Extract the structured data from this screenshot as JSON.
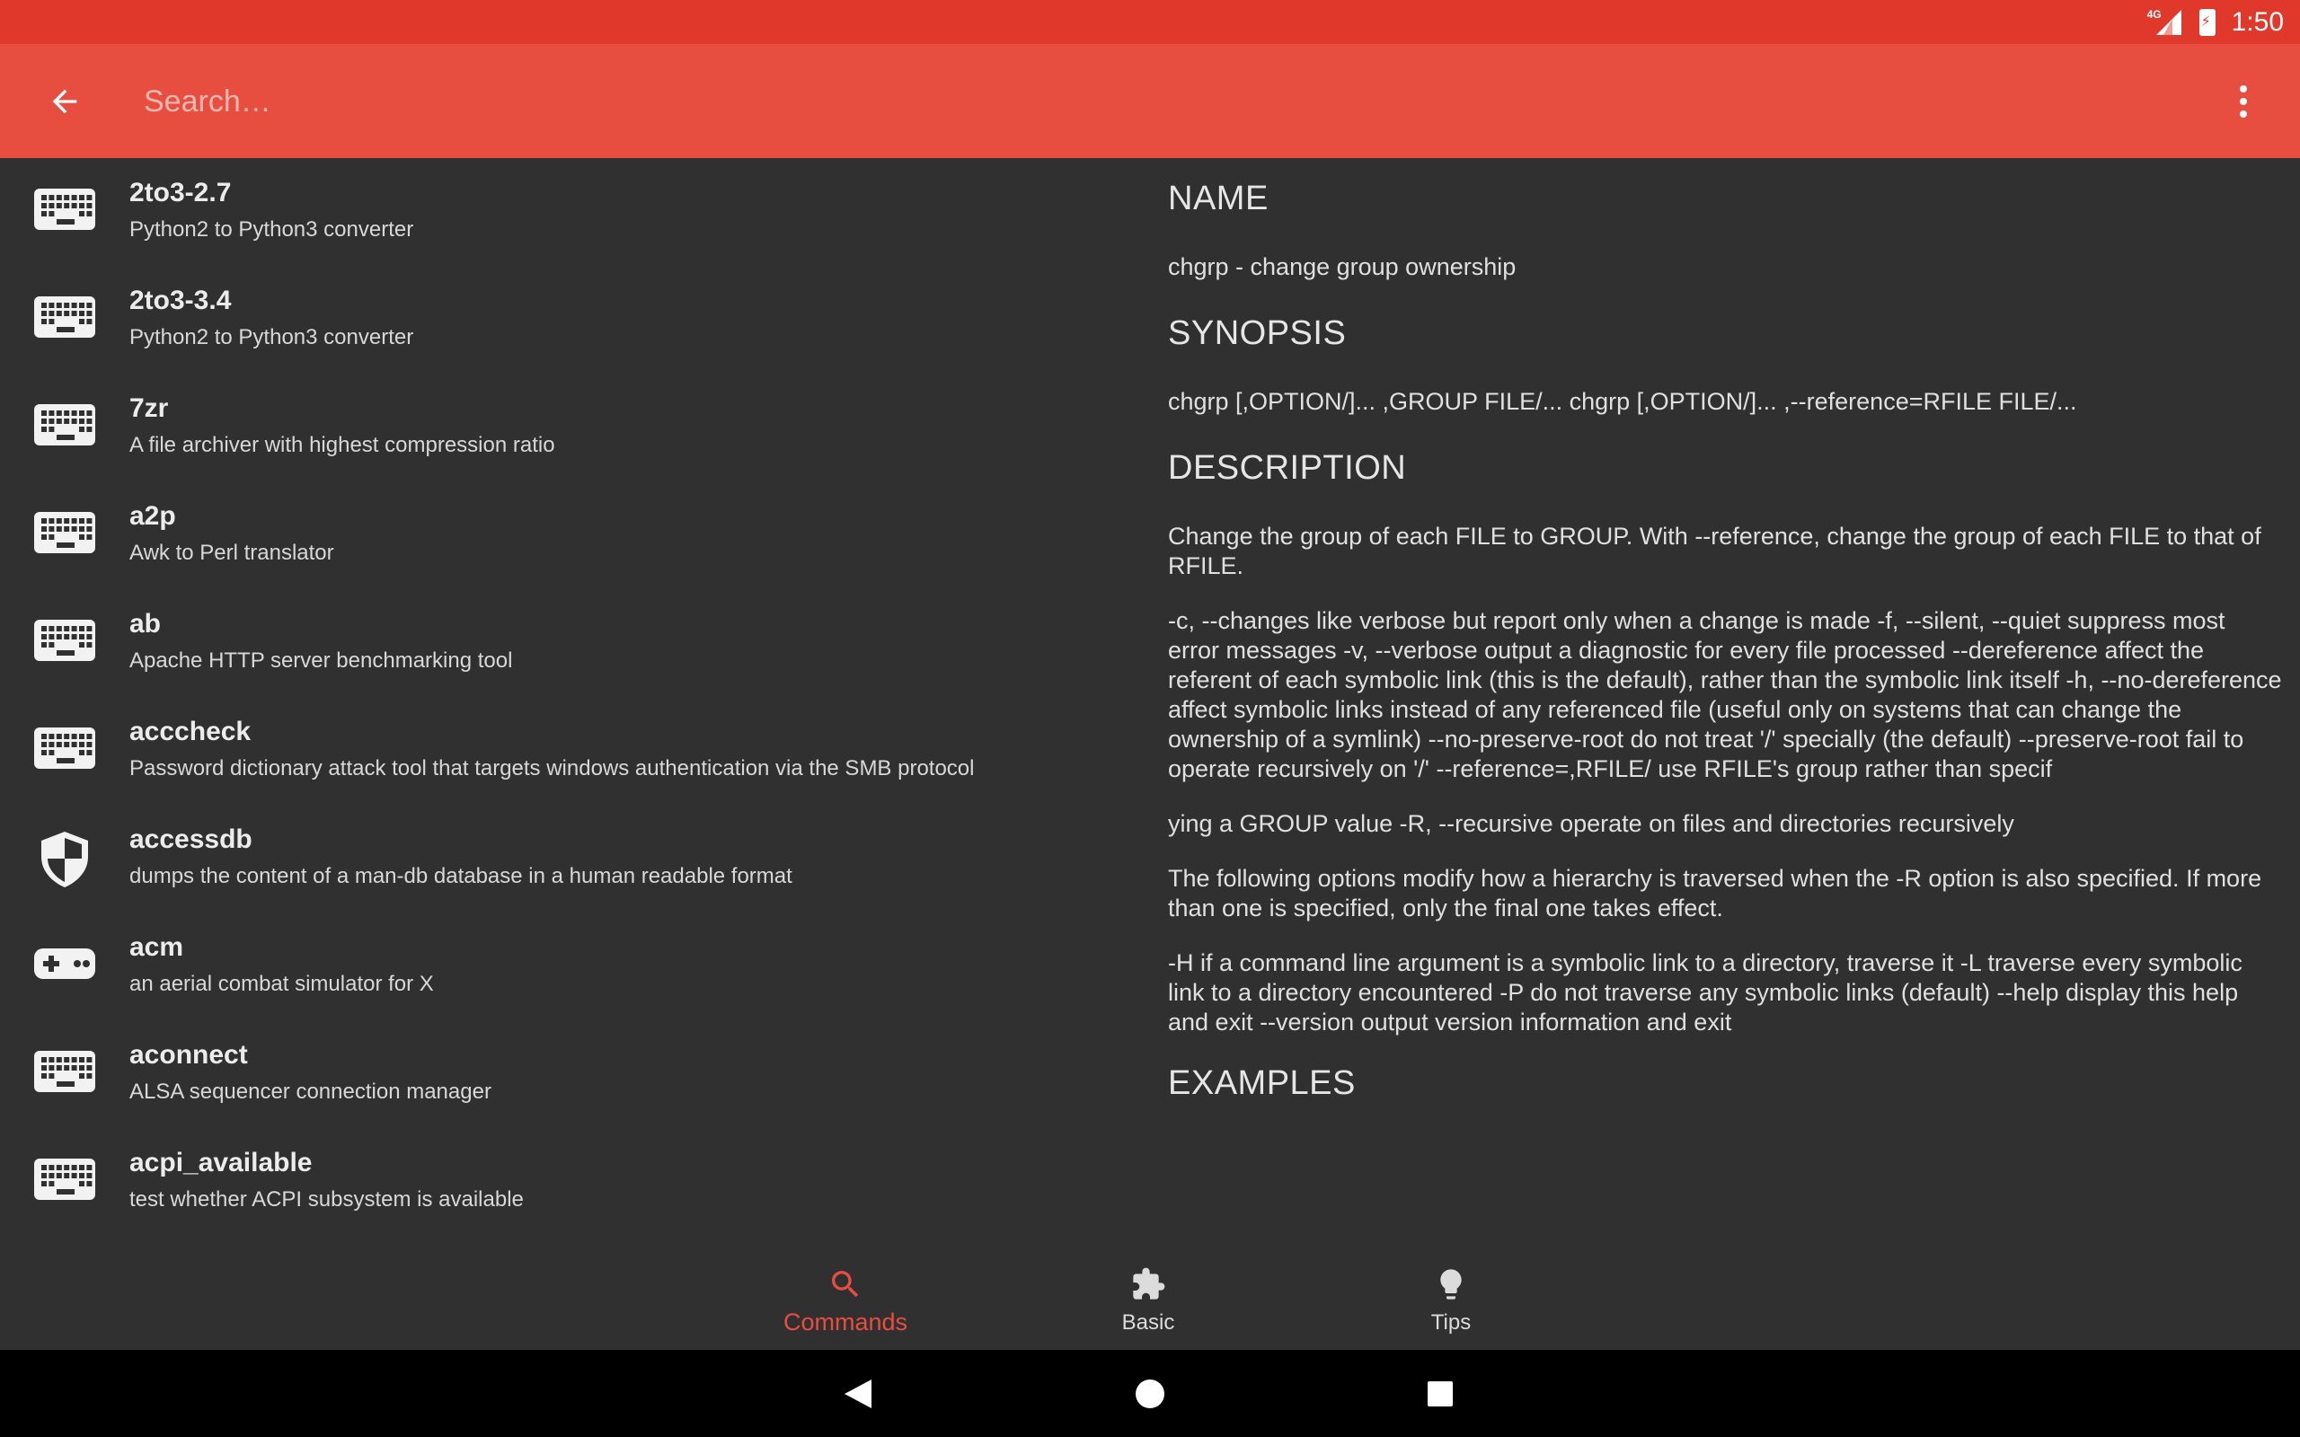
{
  "status_bar": {
    "time": "1:50",
    "network": "4G"
  },
  "app_bar": {
    "search_placeholder": "Search…"
  },
  "commands": [
    {
      "name": "2to3-2.7",
      "description": "Python2 to Python3 converter",
      "icon": "keyboard-icon"
    },
    {
      "name": "2to3-3.4",
      "description": "Python2 to Python3 converter",
      "icon": "keyboard-icon"
    },
    {
      "name": "7zr",
      "description": "A file archiver with highest compression ratio",
      "icon": "keyboard-icon"
    },
    {
      "name": "a2p",
      "description": "Awk to Perl translator",
      "icon": "keyboard-icon"
    },
    {
      "name": "ab",
      "description": "Apache HTTP server benchmarking tool",
      "icon": "keyboard-icon"
    },
    {
      "name": "acccheck",
      "description": "Password dictionary attack tool that targets windows authentication via the SMB protocol",
      "icon": "keyboard-icon"
    },
    {
      "name": "accessdb",
      "description": "dumps the content of a man-db database in a human readable format",
      "icon": "shield-icon"
    },
    {
      "name": "acm",
      "description": "an aerial combat simulator for X",
      "icon": "gamepad-icon"
    },
    {
      "name": "aconnect",
      "description": "ALSA sequencer connection manager",
      "icon": "keyboard-icon"
    },
    {
      "name": "acpi_available",
      "description": "test whether ACPI subsystem is available",
      "icon": "keyboard-icon"
    }
  ],
  "detail": {
    "name_heading": "NAME",
    "name_text": "chgrp - change group ownership",
    "synopsis_heading": "SYNOPSIS",
    "synopsis_text": "chgrp [,OPTION/]... ,GROUP FILE/... chgrp [,OPTION/]... ,--reference=RFILE FILE/...",
    "description_heading": "DESCRIPTION",
    "description_p1": "Change the group of each FILE to GROUP. With --reference, change the group of each FILE to that of RFILE.",
    "description_p2": "-c, --changes like verbose but report only when a change is made -f, --silent, --quiet suppress most error messages -v, --verbose output a diagnostic for every file processed --dereference affect the referent of each symbolic link (this is the default), rather than the symbolic link itself -h, --no-dereference affect symbolic links instead of any referenced file (useful only on systems that can change the ownership of a symlink) --no-preserve-root do not treat '/' specially (the default) --preserve-root fail to operate recursively on '/' --reference=,RFILE/ use RFILE's group rather than specif",
    "description_p3": "ying a GROUP value -R, --recursive operate on files and directories recursively",
    "description_p4": "The following options modify how a hierarchy is traversed when the -R option is also specified. If more than one is specified, only the final one takes effect.",
    "description_p5": "-H if a command line argument is a symbolic link to a directory, traverse it -L traverse every symbolic link to a directory encountered -P do not traverse any symbolic links (default) --help display this help and exit --version output version information and exit",
    "examples_heading": "EXAMPLES"
  },
  "bottom_nav": {
    "tabs": [
      {
        "label": "Commands",
        "icon": "search-icon",
        "active": true
      },
      {
        "label": "Basic",
        "icon": "puzzle-icon",
        "active": false
      },
      {
        "label": "Tips",
        "icon": "lightbulb-icon",
        "active": false
      }
    ]
  },
  "colors": {
    "status_bar": "#e0392b",
    "app_bar": "#e84e40",
    "background": "#303030",
    "accent": "#e84e40"
  }
}
